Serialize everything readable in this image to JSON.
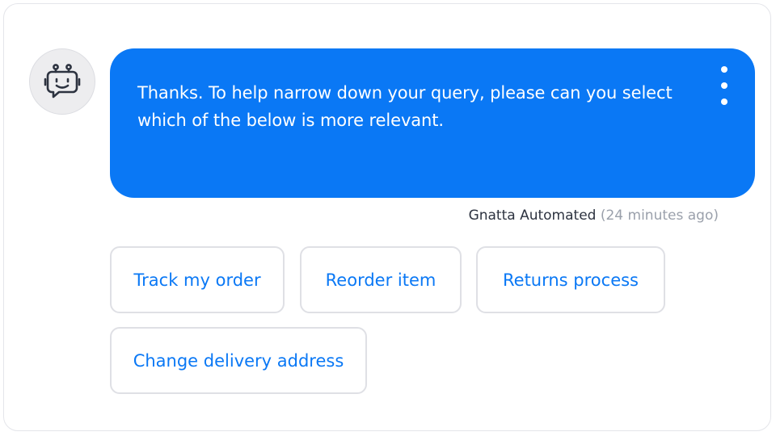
{
  "bot": {
    "avatar_icon": "robot-icon",
    "sender": "Gnatta Automated",
    "timestamp": "(24 minutes ago)"
  },
  "message": {
    "text": "Thanks. To help narrow down your query, please can you select which of the below is more relevant.",
    "menu_icon": "more-vertical-icon"
  },
  "quick_replies": [
    {
      "label": "Track my order"
    },
    {
      "label": "Reorder item"
    },
    {
      "label": "Returns process"
    },
    {
      "label": "Change delivery address"
    }
  ],
  "colors": {
    "accent": "#0a78f5",
    "meta_text": "#2d3340",
    "muted_text": "#9aa0ab",
    "border": "#dfe0e5"
  }
}
